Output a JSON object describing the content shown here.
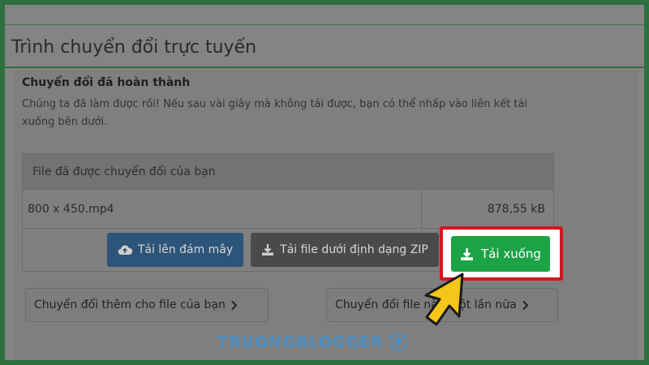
{
  "page": {
    "title": "Trình chuyển đổi trực tuyến"
  },
  "conversion": {
    "heading": "Chuyển đổi đã hoàn thành",
    "message": "Chúng ta đã làm được rồi! Nếu sau vài giây mà không tải được, bạn có thể nhấp vào liên kết tải xuống bên dưới."
  },
  "files_panel": {
    "header": "File đã được chuyển đổi của bạn",
    "file": {
      "name": "800 x 450.mp4",
      "size": "878,55 kB"
    }
  },
  "actions": {
    "cloud_label": "Tải lên đám mây",
    "zip_label": "Tải file dưới định dạng ZIP",
    "download_label": "Tải xuống",
    "more_label": "Chuyển đổi thêm cho file của bạn",
    "again_label": "Chuyển đổi file này một lần nữa"
  },
  "icons": {
    "cloud": "cloud-upload-icon",
    "zip": "download-icon",
    "download": "download-icon",
    "chevron": "chevron-right-icon",
    "cursor": "arrow-cursor-icon",
    "logo": "lightbulb-logo-icon"
  },
  "watermark": {
    "text": "TRUONGBLOGGER"
  },
  "colors": {
    "frame_green": "#2e6f3e",
    "download_green": "#1ca345",
    "highlight_red": "#d8141e",
    "cloud_blue": "#2d5479",
    "cursor_yellow": "#f5c518",
    "watermark_blue": "#4b8ec2"
  }
}
